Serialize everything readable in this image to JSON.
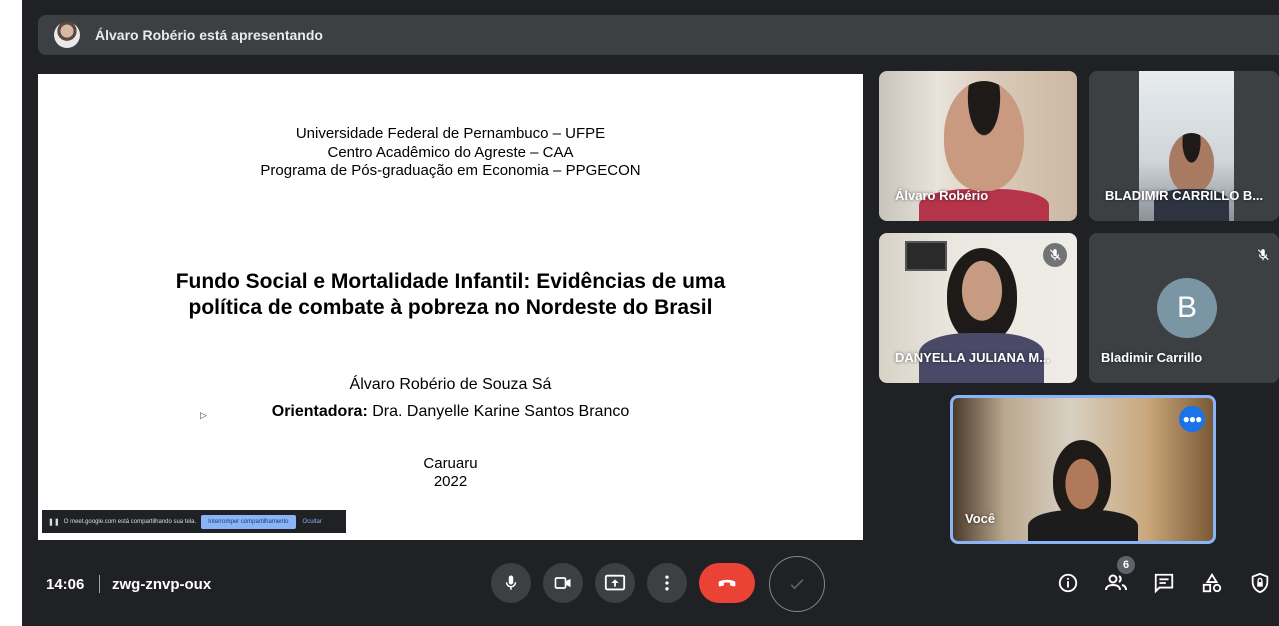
{
  "presenter_bar": {
    "text": "Álvaro Robério está apresentando"
  },
  "slide": {
    "institution_lines": [
      "Universidade Federal de Pernambuco – UFPE",
      "Centro Acadêmico do Agreste – CAA",
      "Programa de Pós-graduação em Economia – PPGECON"
    ],
    "title_lines": [
      "Fundo Social e Mortalidade Infantil: Evidências de uma",
      "política de combate à pobreza no Nordeste do Brasil"
    ],
    "author": "Álvaro Robério de Souza Sá",
    "advisor_label": "Orientadora:",
    "advisor_name": " Dra. Danyelle Karine Santos Branco",
    "city": "Caruaru",
    "year": "2022",
    "share_banner": {
      "message": "O meet.google.com está compartilhando sua tela.",
      "stop_label": "Interromper compartilhamento",
      "hide_label": "Ocultar"
    }
  },
  "participants": {
    "alvaro": {
      "name": "Álvaro Robério"
    },
    "bladimir_video": {
      "name": "BLADIMIR CARRILLO B..."
    },
    "danyella": {
      "name": "DANYELLA JULIANA M..."
    },
    "bladimir": {
      "name": "Bladimir Carrillo",
      "initial": "B"
    },
    "self": {
      "name": "Você"
    }
  },
  "bottom_bar": {
    "time": "14:06",
    "meeting_code": "zwg-znvp-oux",
    "people_count": "6"
  },
  "colors": {
    "background": "#202124",
    "surface": "#3c4043",
    "end_call": "#ea4335",
    "accent_blue": "#8ab4f8",
    "active_blue": "#1a73e8"
  }
}
